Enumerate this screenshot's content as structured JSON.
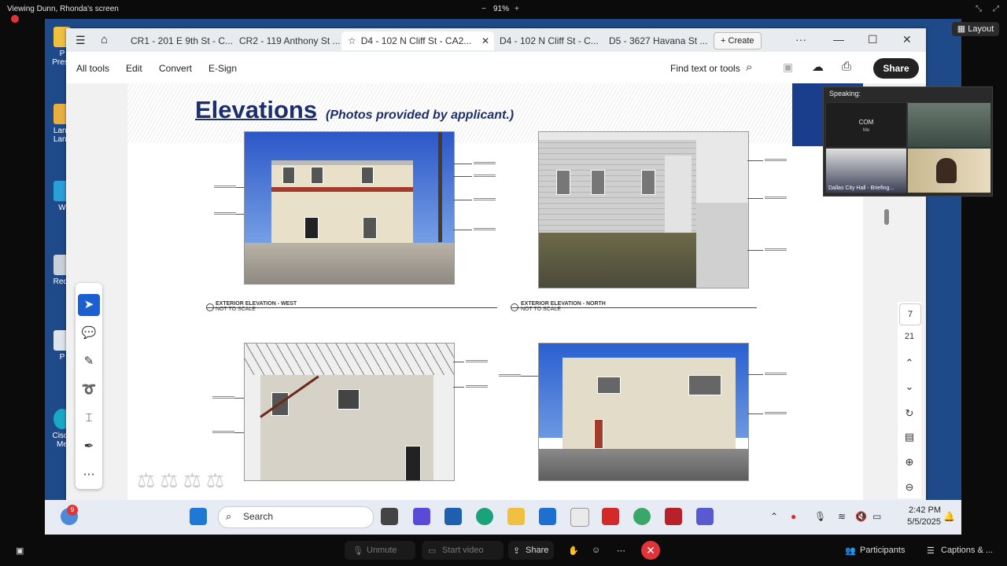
{
  "zoom": {
    "viewing_label": "Viewing Dunn, Rhonda's screen",
    "zoom_minus": "−",
    "zoom_level": "91%",
    "zoom_plus": "+",
    "layout_label": "Layout",
    "speaking_label": "Speaking:",
    "video_tiles": [
      {
        "name": "COM",
        "sub": "Me"
      },
      {
        "name": "",
        "sub": ""
      },
      {
        "name": "Dallas City Hall - Briefing...",
        "sub": ""
      },
      {
        "name": "",
        "sub": ""
      }
    ],
    "bottom": {
      "unmute": "Unmute",
      "start_video": "Start video",
      "share": "Share",
      "participants": "Participants",
      "captions": "Captions & ..."
    }
  },
  "acrobat": {
    "tabs": [
      {
        "label": "CR1 - 201 E 9th St - C..."
      },
      {
        "label": "CR2 - 119 Anthony St ..."
      },
      {
        "label": "D4 - 102 N Cliff St - CA2...",
        "active": true
      },
      {
        "label": "D4 - 102 N Cliff St - C..."
      },
      {
        "label": "D5 - 3627 Havana St ..."
      }
    ],
    "create_label": "Create",
    "toolbar": {
      "all_tools": "All tools",
      "edit": "Edit",
      "convert": "Convert",
      "esign": "E-Sign",
      "find": "Find text or tools",
      "share": "Share"
    },
    "page_numbers": {
      "current": "7",
      "total": "21"
    }
  },
  "document": {
    "title": "Elevations",
    "subtitle": "(Photos provided by applicant.)",
    "elevations": [
      {
        "label": "EXTERIOR ELEVATION - WEST",
        "scale": "NOT TO SCALE"
      },
      {
        "label": "EXTERIOR ELEVATION - NORTH",
        "scale": "NOT TO SCALE"
      }
    ]
  },
  "desktop": {
    "icons": [
      "P\nPresc",
      "Land\nLand",
      "W",
      "Recy",
      "P",
      "Cisco\nMe"
    ]
  },
  "taskbar": {
    "search": "Search",
    "time": "2:42 PM",
    "date": "5/5/2025",
    "badge": "9"
  }
}
